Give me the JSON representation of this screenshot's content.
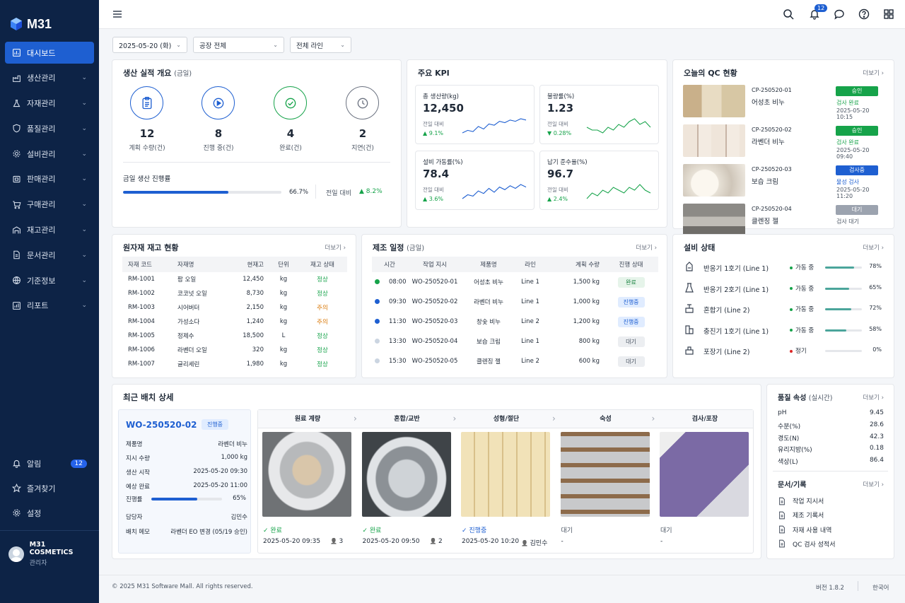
{
  "brand": {
    "name": "M31"
  },
  "nav": [
    {
      "label": "대시보드",
      "icon": "dashboard-icon",
      "active": true
    },
    {
      "label": "생산관리",
      "icon": "factory-icon"
    },
    {
      "label": "자재관리",
      "icon": "flask-icon"
    },
    {
      "label": "품질관리",
      "icon": "shield-icon"
    },
    {
      "label": "설비관리",
      "icon": "gear-icon"
    },
    {
      "label": "판매관리",
      "icon": "store-icon"
    },
    {
      "label": "구매관리",
      "icon": "cart-icon"
    },
    {
      "label": "재고관리",
      "icon": "warehouse-icon"
    },
    {
      "label": "문서관리",
      "icon": "document-icon"
    },
    {
      "label": "기준정보",
      "icon": "globe-icon"
    },
    {
      "label": "리포트",
      "icon": "chart-icon"
    }
  ],
  "side_bottom": {
    "alerts": "알림",
    "alerts_count": "12",
    "favorites": "즐겨찾기",
    "settings": "설정"
  },
  "profile": {
    "name": "M31 COSMETICS",
    "role": "관리자"
  },
  "topbar": {
    "notifications": "12"
  },
  "filters": {
    "date": "2025-05-20 (화)",
    "plant": "공장 전체",
    "line": "전체 라인"
  },
  "production": {
    "title": "생산 실적 개요",
    "title_sub": "(금일)",
    "stats": [
      {
        "value": "12",
        "label": "계획 수량(건)",
        "icon": "clipboard-icon",
        "color": "#1e5fd1"
      },
      {
        "value": "8",
        "label": "진행 중(건)",
        "icon": "play-icon",
        "color": "#1e5fd1"
      },
      {
        "value": "4",
        "label": "완료(건)",
        "icon": "check-icon",
        "color": "#16a34a"
      },
      {
        "value": "2",
        "label": "지연(건)",
        "icon": "clock-icon",
        "color": "#6b7280"
      }
    ],
    "progress_label": "금일 생산 진행률",
    "progress_value": "66.7%",
    "progress_frac": 0.667,
    "compare_label": "전일 대비",
    "compare_value": "8.2%"
  },
  "kpi": {
    "title": "주요 KPI",
    "items": [
      {
        "title": "총 생산량(kg)",
        "value": "12,450",
        "cmp": "전일 대비",
        "delta": "9.1%",
        "dir": "up",
        "spark": [
          6,
          8,
          7,
          11,
          9,
          13,
          12,
          15,
          14,
          16,
          15,
          17,
          16
        ]
      },
      {
        "title": "불량률(%)",
        "value": "1.23",
        "cmp": "전일 대비",
        "delta": "0.28%",
        "dir": "down",
        "spark": [
          10,
          9,
          9,
          8,
          10,
          9,
          11,
          10,
          12,
          13,
          11,
          12,
          10
        ]
      },
      {
        "title": "설비 가동률(%)",
        "value": "78.4",
        "cmp": "전일 대비",
        "delta": "3.6%",
        "dir": "up",
        "spark": [
          4,
          7,
          6,
          10,
          8,
          12,
          9,
          13,
          11,
          14,
          12,
          15,
          13
        ]
      },
      {
        "title": "납기 준수율(%)",
        "value": "96.7",
        "cmp": "전일 대비",
        "delta": "2.4%",
        "dir": "up",
        "spark": [
          9,
          11,
          10,
          12,
          11,
          13,
          12,
          11,
          13,
          12,
          14,
          12,
          11
        ]
      }
    ]
  },
  "qc": {
    "title": "오늘의 QC 현황",
    "more": "더보기",
    "items": [
      {
        "code": "CP-250520-01",
        "name": "어성초 비누",
        "badge": "승인",
        "badge_color": "#16a34a",
        "status": "검사 완료",
        "status_color": "#16a34a",
        "date": "2025-05-20 10:15"
      },
      {
        "code": "CP-250520-02",
        "name": "라벤더 비누",
        "badge": "승인",
        "badge_color": "#16a34a",
        "status": "검사 완료",
        "status_color": "#16a34a",
        "date": "2025-05-20 09:40"
      },
      {
        "code": "CP-250520-03",
        "name": "보습 크림",
        "badge": "검사중",
        "badge_color": "#1e5fd1",
        "status": "물성 검사",
        "status_color": "#1e5fd1",
        "date": "2025-05-20 11:20"
      },
      {
        "code": "CP-250520-04",
        "name": "클렌징 젤",
        "badge": "대기",
        "badge_color": "#9ca3af",
        "status": "검사 대기",
        "status_color": "#4b5563",
        "date": ""
      }
    ]
  },
  "inventory": {
    "title": "원자재 재고 현황",
    "more": "더보기",
    "headers": [
      "자재 코드",
      "자재명",
      "현재고",
      "단위",
      "재고 상태"
    ],
    "rows": [
      [
        "RM-1001",
        "팜 오일",
        "12,450",
        "kg",
        "정상"
      ],
      [
        "RM-1002",
        "코코넛 오일",
        "8,730",
        "kg",
        "정상"
      ],
      [
        "RM-1003",
        "시어버터",
        "2,150",
        "kg",
        "주의"
      ],
      [
        "RM-1004",
        "가성소다",
        "1,240",
        "kg",
        "주의"
      ],
      [
        "RM-1005",
        "정제수",
        "18,500",
        "L",
        "정상"
      ],
      [
        "RM-1006",
        "라벤더 오일",
        "320",
        "kg",
        "정상"
      ],
      [
        "RM-1007",
        "글리세린",
        "1,980",
        "kg",
        "정상"
      ]
    ]
  },
  "schedule": {
    "title": "제조 일정",
    "title_sub": "(금일)",
    "more": "더보기",
    "headers": [
      "시간",
      "작업 지시",
      "제품명",
      "라인",
      "계획 수량",
      "진행 상태"
    ],
    "rows": [
      {
        "time": "08:00",
        "wo": "WO-250520-01",
        "product": "어성초 비누",
        "line": "Line 1",
        "qty": "1,500 kg",
        "status": "완료",
        "kind": "done",
        "dot": "#16a34a"
      },
      {
        "time": "09:30",
        "wo": "WO-250520-02",
        "product": "라벤더 비누",
        "line": "Line 1",
        "qty": "1,000 kg",
        "status": "진행중",
        "kind": "run",
        "dot": "#1e5fd1"
      },
      {
        "time": "11:30",
        "wo": "WO-250520-03",
        "product": "창숯 비누",
        "line": "Line 2",
        "qty": "1,200 kg",
        "status": "진행중",
        "kind": "run",
        "dot": "#1e5fd1"
      },
      {
        "time": "13:30",
        "wo": "WO-250520-04",
        "product": "보습 크림",
        "line": "Line 1",
        "qty": "800 kg",
        "status": "대기",
        "kind": "wait",
        "dot": "#cbd5e1"
      },
      {
        "time": "15:30",
        "wo": "WO-250520-05",
        "product": "클렌징 젤",
        "line": "Line 2",
        "qty": "600 kg",
        "status": "대기",
        "kind": "wait",
        "dot": "#cbd5e1"
      }
    ]
  },
  "equipment": {
    "title": "설비 상태",
    "more": "더보기",
    "rows": [
      {
        "name": "반응기 1호기 (Line 1)",
        "status": "가동 중",
        "dot": "#16a34a",
        "pct": "78%",
        "frac": 0.78
      },
      {
        "name": "반응기 2호기 (Line 1)",
        "status": "가동 중",
        "dot": "#16a34a",
        "pct": "65%",
        "frac": 0.65
      },
      {
        "name": "혼합기 (Line 2)",
        "status": "가동 중",
        "dot": "#16a34a",
        "pct": "72%",
        "frac": 0.72
      },
      {
        "name": "충진기 1호기 (Line 1)",
        "status": "가동 중",
        "dot": "#16a34a",
        "pct": "58%",
        "frac": 0.58
      },
      {
        "name": "포장기 (Line 2)",
        "status": "정기",
        "dot": "#dc2626",
        "pct": "0%",
        "frac": 0
      }
    ]
  },
  "batch": {
    "title": "최근 배치 상세",
    "wo": "WO-250520-02",
    "badge": "진행중",
    "fields": [
      {
        "k": "제품명",
        "v": "라벤더 비누"
      },
      {
        "k": "지시 수량",
        "v": "1,000 kg"
      },
      {
        "k": "생산 시작",
        "v": "2025-05-20 09:30"
      },
      {
        "k": "예상 완료",
        "v": "2025-05-20 11:00"
      }
    ],
    "progress_label": "진행률",
    "progress_value": "65%",
    "progress_frac": 0.65,
    "owner_k": "담당자",
    "owner_v": "김민수",
    "memo_k": "배치 메모",
    "memo_v": "라벤더 EO 변경 (05/19 승인)",
    "stages": [
      {
        "name": "원료 계량",
        "status": "완료",
        "kind": "done",
        "date": "2025-05-20 09:35",
        "user": "3"
      },
      {
        "name": "혼합/교반",
        "status": "완료",
        "kind": "done",
        "date": "2025-05-20 09:50",
        "user": "2"
      },
      {
        "name": "성형/절단",
        "status": "진행중",
        "kind": "run",
        "date": "2025-05-20 10:20",
        "user": "김민수"
      },
      {
        "name": "숙성",
        "status": "대기",
        "kind": "wait",
        "date": "-",
        "user": ""
      },
      {
        "name": "검사/포장",
        "status": "대기",
        "kind": "wait",
        "date": "-",
        "user": ""
      }
    ]
  },
  "quality": {
    "title": "품질 속성",
    "title_sub": "(실시간)",
    "more": "더보기",
    "rows": [
      {
        "k": "pH",
        "v": "9.45"
      },
      {
        "k": "수분(%)",
        "v": "28.6"
      },
      {
        "k": "경도(N)",
        "v": "42.3"
      },
      {
        "k": "유리지방(%)",
        "v": "0.18"
      },
      {
        "k": "색상(L)",
        "v": "86.4"
      }
    ]
  },
  "docs": {
    "title": "문서/기록",
    "more": "더보기",
    "items": [
      "작업 지시서",
      "제조 기록서",
      "자재 사용 내역",
      "QC 검사 성적서"
    ]
  },
  "footer": {
    "copyright": "© 2025 M31 Software Mall. All rights reserved.",
    "version": "버전 1.8.2",
    "lang": "한국어"
  }
}
